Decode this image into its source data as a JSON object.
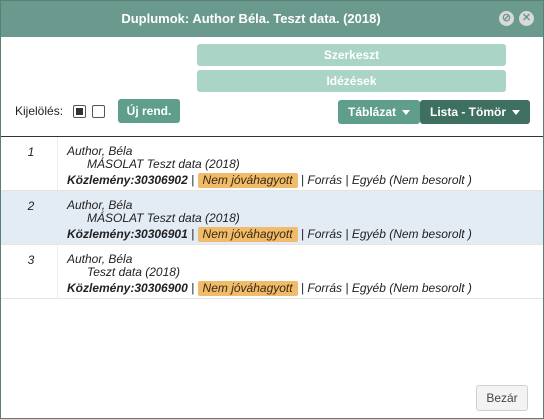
{
  "dialog": {
    "title": "Duplumok: Author Béla. Teszt data. (2018)",
    "btn_minimize_glyph": "⊘",
    "btn_close_glyph": "✕"
  },
  "toolbar": {
    "edit_label": "Szerkeszt",
    "cite_label": "Idézések",
    "selection_label": "Kijelölés:",
    "new_order_label": "Új rend.",
    "table_label": "Táblázat",
    "list_label": "Lista - Tömör"
  },
  "rows": [
    {
      "num": "1",
      "author": "Author, Béla",
      "title": "MÁSOLAT Teszt data (2018)",
      "kozl_label": "Közlemény:",
      "kozl_id": "30306902",
      "status": "Nem jóváhagyott",
      "source": "Forrás",
      "type": "Egyéb (Nem besorolt )"
    },
    {
      "num": "2",
      "author": "Author, Béla",
      "title": "MÁSOLAT Teszt data (2018)",
      "kozl_label": "Közlemény:",
      "kozl_id": "30306901",
      "status": "Nem jóváhagyott",
      "source": "Forrás",
      "type": "Egyéb (Nem besorolt )"
    },
    {
      "num": "3",
      "author": "Author, Béla",
      "title": "Teszt data (2018)",
      "kozl_label": "Közlemény:",
      "kozl_id": "30306900",
      "status": "Nem jóváhagyott",
      "source": "Forrás",
      "type": "Egyéb (Nem besorolt )"
    }
  ],
  "footer": {
    "close_label": "Bezár"
  },
  "colors": {
    "titlebar": "#6a9a8d",
    "light_button": "#a9d4c6",
    "green_button": "#5f9e8c",
    "dark_button": "#3f6f60",
    "badge": "#f0bb6a",
    "selected_row": "#e3ebf5"
  }
}
